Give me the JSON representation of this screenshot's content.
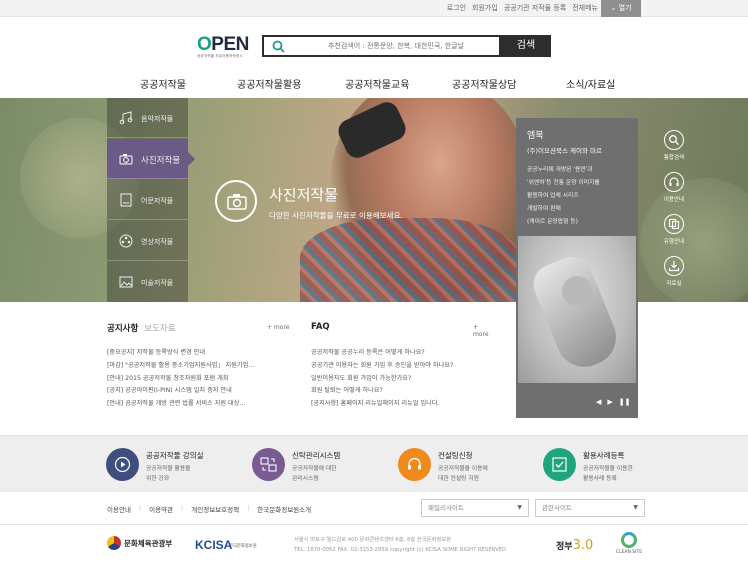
{
  "topbar": {
    "links": [
      "로그인",
      "회원가입",
      "공공기관 저작물 등록",
      "전체메뉴"
    ],
    "open_label": "열기"
  },
  "logo": {
    "word_o": "O",
    "word_rest": "PEN",
    "sub": "공공저작물 자유이용허락표시"
  },
  "search": {
    "placeholder": "추천검색어 : 전통문양, 한복, 대한민국, 한글날",
    "button": "검색"
  },
  "gnb": [
    "공공저작물",
    "공공저작물활용",
    "공공저작물교육",
    "공공저작물상담",
    "소식/자료실"
  ],
  "lnb": [
    {
      "label": "음악저작물",
      "icon": "music-icon",
      "active": false
    },
    {
      "label": "사진저작물",
      "icon": "camera-icon",
      "active": true
    },
    {
      "label": "어문저작물",
      "icon": "book-icon",
      "active": false
    },
    {
      "label": "영상저작물",
      "icon": "film-reel-icon",
      "active": false
    },
    {
      "label": "미술저작물",
      "icon": "picture-icon",
      "active": false
    }
  ],
  "hero": {
    "title": "사진저작물",
    "desc": "다양한 사진저작물을 무료로 이용해보세요."
  },
  "panel": {
    "title": "엠북",
    "subtitle": "(주)이모션북스 케이와 미르",
    "desc_lines": [
      "공공누리에 개방된 '용연'과",
      "'위엔허'등 전통 문양 이미지를",
      "활용하여 업체 시리즈",
      "개발하여 판매",
      "(캐이르 문양팝형 등)"
    ]
  },
  "quick": [
    {
      "label": "통합검색",
      "icon": "search-icon"
    },
    {
      "label": "이용안내",
      "icon": "headset-icon"
    },
    {
      "label": "유형안내",
      "icon": "copy-icon"
    },
    {
      "label": "자료실",
      "icon": "download-icon"
    }
  ],
  "notice": {
    "tab_on": "공지사항",
    "tab_off": "보도자료",
    "more": "+ more",
    "items": [
      "[중요공지] 저작물 등록방식 변경 안내",
      "[마감] \"공공저작물 활용 중소기업지원사업」 지원기업...",
      "[안내] 2015 공공저작물 창조자원화 포럼 개최",
      "[공지] 공공아이핀(I-PIN) 시스템 일지 중지 안내",
      "[안내] 공공저작물 개방 관련 법률 서비스 지원 대상..."
    ]
  },
  "faq": {
    "title": "FAQ",
    "more": "+ more",
    "items": [
      "공공저작물 공공누리 등록은 어떻게 하나요?",
      "공공기관 이용자는 회원 가입 후 승인을 받아야 하나요?",
      "일반이용자도 회원 가입이 가능한가요?",
      "회원 탈퇴는 어떻게 하나요?",
      "[공지사항] 홈페이지 리뉴얼해이지 리뉴얼 입니다."
    ]
  },
  "services": [
    {
      "title": "공공저작물 강의실",
      "desc": [
        "공공저작물 활용을",
        "위한 강좌"
      ],
      "color": "#3f4e7e",
      "icon": "play-icon"
    },
    {
      "title": "신탁관리시스템",
      "desc": [
        "공공저작물에 대한",
        "관리시스템"
      ],
      "color": "#7a5a93",
      "icon": "exchange-icon"
    },
    {
      "title": "컨설팅신청",
      "desc": [
        "공공저작물을 이용에",
        "대한 컨설팅 지원"
      ],
      "color": "#f08a1c",
      "icon": "headset-icon"
    },
    {
      "title": "활용사례등록",
      "desc": [
        "공공저작물을 이용한",
        "활용사례 등록"
      ],
      "color": "#1ea57e",
      "icon": "image-check-icon"
    }
  ],
  "footnav": {
    "links": [
      "이용안내",
      "이용약관",
      "개인정보보호정책",
      "한국문화정보원소개"
    ],
    "select1": "패밀리사이트",
    "select2": "관련사이트"
  },
  "footer": {
    "mcst": "문화체육관광부",
    "kcisa": "KCISA",
    "kcisa_sub": "한국문화정보원",
    "addr1": "서울시 마포구 월드컵로 400 문화콘텐츠센터 6층, 8층 한국문화정보원",
    "addr2": "TEL. 1670-0052 FAX. 02-3153-2859 copyright (c) KCISA SOME RIGHT RESERVED",
    "gov": "정부",
    "gov_num": "3.0",
    "clean": "CLEAN SITE"
  },
  "colors": {
    "accent_purple": "#6b5a85",
    "panel_grey": "#6f6f6f",
    "dark": "#2d2d2d",
    "brand_green": "#1aa08a"
  }
}
